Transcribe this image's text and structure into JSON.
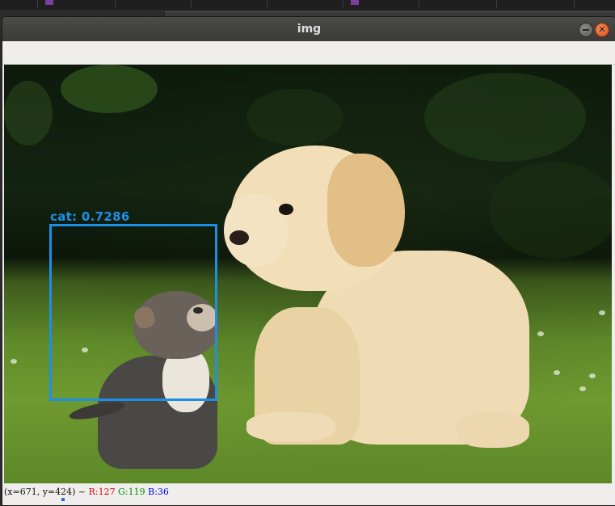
{
  "window": {
    "title": "img"
  },
  "detection": {
    "label": "cat: 0.7286",
    "color": "#1d8fe6"
  },
  "status": {
    "coords": "(x=671, y=424) ~",
    "r": "R:127",
    "g": "G:119",
    "b": "B:36"
  },
  "icons": {
    "minimize": "minimize-icon",
    "close": "close-icon"
  }
}
